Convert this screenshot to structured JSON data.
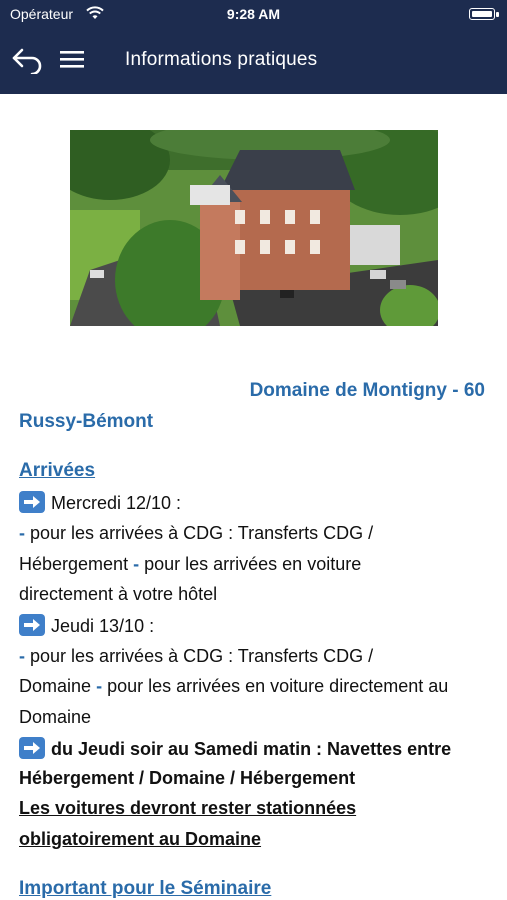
{
  "status_bar": {
    "carrier": "Opérateur",
    "time": "9:28 AM"
  },
  "navbar": {
    "title": "Informations pratiques"
  },
  "venue": {
    "name": "Domaine de Montigny - 60",
    "location": "Russy-Bémont"
  },
  "arrivals": {
    "heading": "Arrivées",
    "day1": "Mercredi 12/10 :",
    "day1_line1_a": "pour les arrivées à CDG : Transferts CDG /",
    "day1_line2_a": "Hébergement",
    "day1_line2_b": "pour les arrivées en voiture",
    "day1_line3": "directement à votre hôtel",
    "day2": "Jeudi 13/10 :",
    "day2_line1_a": "pour les arrivées à CDG : Transferts CDG /",
    "day2_line2_a": "Domaine",
    "day2_line2_b": "pour les arrivées en voiture directement au",
    "day2_line3": "Domaine",
    "shuttle_line1": "du Jeudi soir au Samedi matin : Navettes entre",
    "shuttle_line2": "Hébergement / Domaine / Hébergement",
    "parking_line1": "Les voitures devront rester stationnées",
    "parking_line2": "obligatoirement au Domaine",
    "dash": "-"
  },
  "seminar": {
    "heading": "Important pour le Séminaire"
  },
  "colors": {
    "header_bg": "#1d2c4f",
    "link_blue": "#2a6ba9",
    "arrow_box": "#3f7fc9"
  }
}
